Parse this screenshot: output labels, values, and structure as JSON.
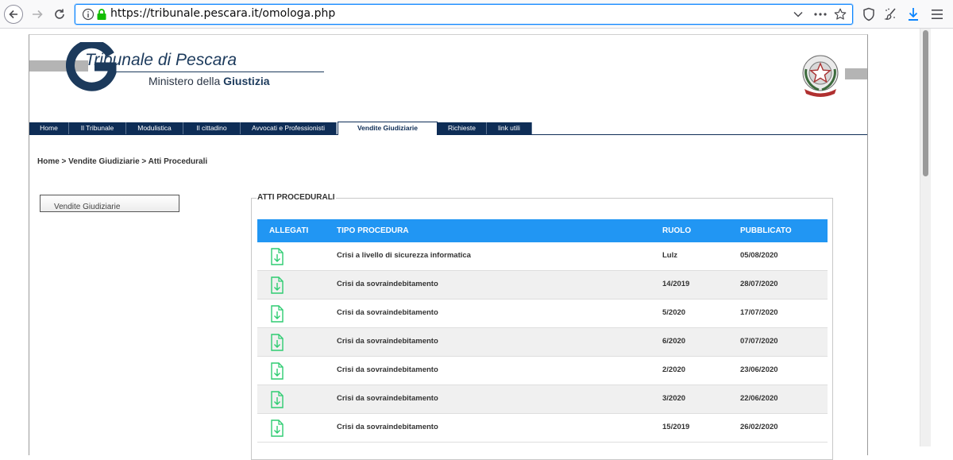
{
  "browser": {
    "url": "https://tribunale.pescara.it/omologa.php"
  },
  "site": {
    "title": "Tribunale di Pescara",
    "subtitle_prefix": "Ministero della ",
    "subtitle_bold": "Giustizia"
  },
  "nav": {
    "items": [
      {
        "label": "Home"
      },
      {
        "label": "Il Tribunale"
      },
      {
        "label": "Modulistica"
      },
      {
        "label": "Il cittadino"
      },
      {
        "label": "Avvocati e Professionisti"
      },
      {
        "label": "Vendite Giudiziarie",
        "active": true
      },
      {
        "label": "Richieste"
      },
      {
        "label": "link utili"
      }
    ]
  },
  "breadcrumb": "Home > Vendite Giudiziarie > Atti Procedurali",
  "sidebar": {
    "button_label": "Vendite Giudiziarie"
  },
  "atti": {
    "legend": "ATTI PROCEDURALI",
    "headers": [
      "ALLEGATI",
      "TIPO PROCEDURA",
      "RUOLO",
      "PUBBLICATO"
    ],
    "rows": [
      {
        "tipo": "Crisi a livello di sicurezza informatica",
        "ruolo": "Lulz",
        "pubblicato": "05/08/2020"
      },
      {
        "tipo": "Crisi da sovraindebitamento",
        "ruolo": "14/2019",
        "pubblicato": "28/07/2020"
      },
      {
        "tipo": "Crisi da sovraindebitamento",
        "ruolo": "5/2020",
        "pubblicato": "17/07/2020"
      },
      {
        "tipo": "Crisi da sovraindebitamento",
        "ruolo": "6/2020",
        "pubblicato": "07/07/2020"
      },
      {
        "tipo": "Crisi da sovraindebitamento",
        "ruolo": "2/2020",
        "pubblicato": "23/06/2020"
      },
      {
        "tipo": "Crisi da sovraindebitamento",
        "ruolo": "3/2020",
        "pubblicato": "22/06/2020"
      },
      {
        "tipo": "Crisi da sovraindebitamento",
        "ruolo": "15/2019",
        "pubblicato": "26/02/2020"
      }
    ]
  },
  "colors": {
    "nav_bg": "#0e2d56",
    "table_header": "#2196f3",
    "download_icon": "#2ecc71"
  }
}
